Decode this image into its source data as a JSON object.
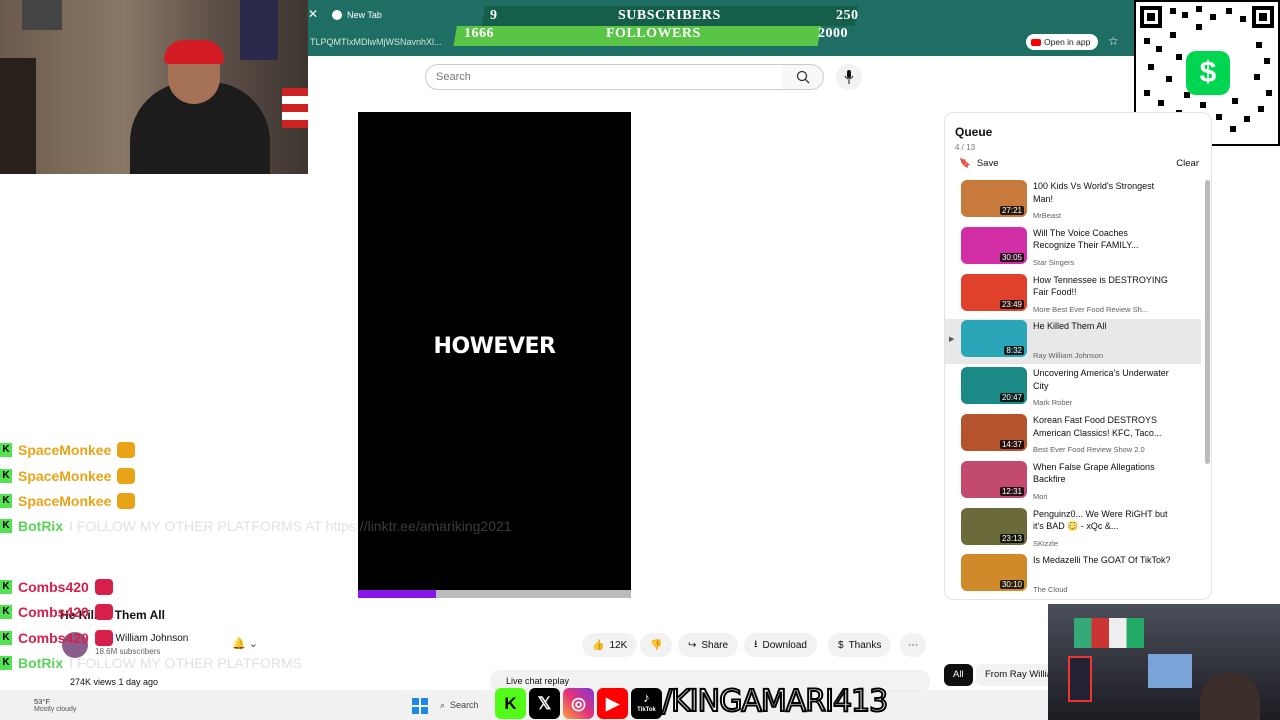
{
  "browser": {
    "tab_label": "New Tab",
    "url_text": "TLPQMTIxMDlwMjWSNavnhXl...",
    "open_in_app": "Open in app"
  },
  "banner": {
    "subscribers_label": "SUBSCRIBERS",
    "subscribers_current": "9",
    "subscribers_goal": "250",
    "followers_label": "FOLLOWERS",
    "followers_current": "1666",
    "followers_goal": "2000"
  },
  "search": {
    "placeholder": "Search"
  },
  "video": {
    "caption": "HOWEVER",
    "progress": 0.285,
    "progress_color": "#8a16e8"
  },
  "below": {
    "title": "He Killed Them All",
    "channel": "Ray William Johnson",
    "subscribers": "18.6M subscribers",
    "likes": "12K",
    "share": "Share",
    "download": "Download",
    "thanks": "Thanks",
    "views": "274K views  1 day ago",
    "live_chat": "Live chat replay"
  },
  "queue": {
    "title": "Queue",
    "count": "4 / 13",
    "save": "Save",
    "clear": "Clear",
    "items": [
      {
        "title": "100 Kids Vs World's Strongest Man!",
        "channel": "MrBeast",
        "duration": "27:21",
        "color": "#c87a3c"
      },
      {
        "title": "Will The Voice Coaches Recognize Their FAMILY...",
        "channel": "Star Singers",
        "duration": "30:05",
        "color": "#d22fa6"
      },
      {
        "title": "How Tennessee is DESTROYING Fair Food!!",
        "channel": "More Best Ever Food Review Sh...",
        "duration": "23:49",
        "color": "#e0412a"
      },
      {
        "title": "He Killed Them All",
        "channel": "Ray William Johnson",
        "duration": "8:32",
        "color": "#2aa6b8"
      },
      {
        "title": "Uncovering America's Underwater City",
        "channel": "Mark Rober",
        "duration": "20:47",
        "color": "#1b8a86"
      },
      {
        "title": "Korean Fast Food DESTROYS American Classics! KFC, Taco...",
        "channel": "Best Ever Food Review Show 2.0",
        "duration": "14:37",
        "color": "#b5532d"
      },
      {
        "title": "When False Grape Allegations Backfire",
        "channel": "Mori",
        "duration": "12:31",
        "color": "#c24a6e"
      },
      {
        "title": "Penguinz0... We Were RiGHT but it's BAD 😳 - xQc &...",
        "channel": "SKizzle",
        "duration": "23:13",
        "color": "#6a6a3a"
      },
      {
        "title": "Is Medazelli The GOAT Of TikTok?",
        "channel": "The Cloud",
        "duration": "30:10",
        "color": "#d08a2a"
      }
    ]
  },
  "chips": {
    "all": "All",
    "from": "From Ray Willia"
  },
  "chat": {
    "messages": [
      {
        "user": "SpaceMonkee",
        "color": "#e8a317"
      },
      {
        "user": "SpaceMonkee",
        "color": "#e8a317"
      },
      {
        "user": "SpaceMonkee",
        "color": "#e8a317"
      },
      {
        "user": "BotRix",
        "color": "#5bd45b",
        "text": "I FOLLOW MY OTHER PLATFORMS AT https://linktr.ee/amariking2021"
      },
      {
        "user": "Combs420",
        "color": "#d6204a"
      },
      {
        "user": "Combs420",
        "color": "#d6204a"
      },
      {
        "user": "Combs420",
        "color": "#d6204a"
      },
      {
        "user": "BotRix",
        "color": "#5bd45b",
        "text": "I FOLLOW MY OTHER PLATFORMS"
      }
    ],
    "link": "https://linktree/amariking2021"
  },
  "taskbar": {
    "temp": "53°F",
    "weather": "Mostly cloudy",
    "search": "Search"
  },
  "socials": {
    "handle": "/KINGAMARI413",
    "tiktok_label": "TikTok"
  }
}
